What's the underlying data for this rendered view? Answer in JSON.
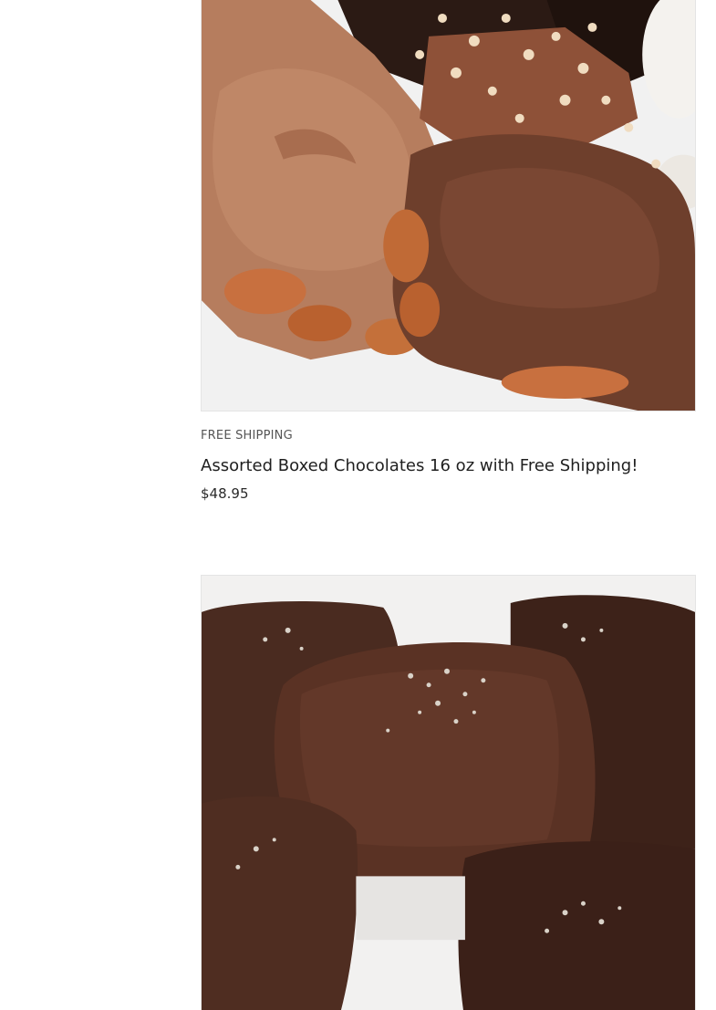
{
  "products": [
    {
      "image_alt": "Chocolate covered pecan turtles with chopped nuts",
      "badge": "FREE SHIPPING",
      "title": "Assorted Boxed Chocolates 16 oz with Free Shipping!",
      "price": "$48.95"
    },
    {
      "image_alt": "Dark chocolate sea salt caramels"
    }
  ],
  "colors": {
    "milk_chocolate": "#b07352",
    "dark_chocolate": "#4a2a1d",
    "pecan": "#c4703a",
    "plate": "#f3f3f3",
    "border": "#e4e4e4"
  }
}
